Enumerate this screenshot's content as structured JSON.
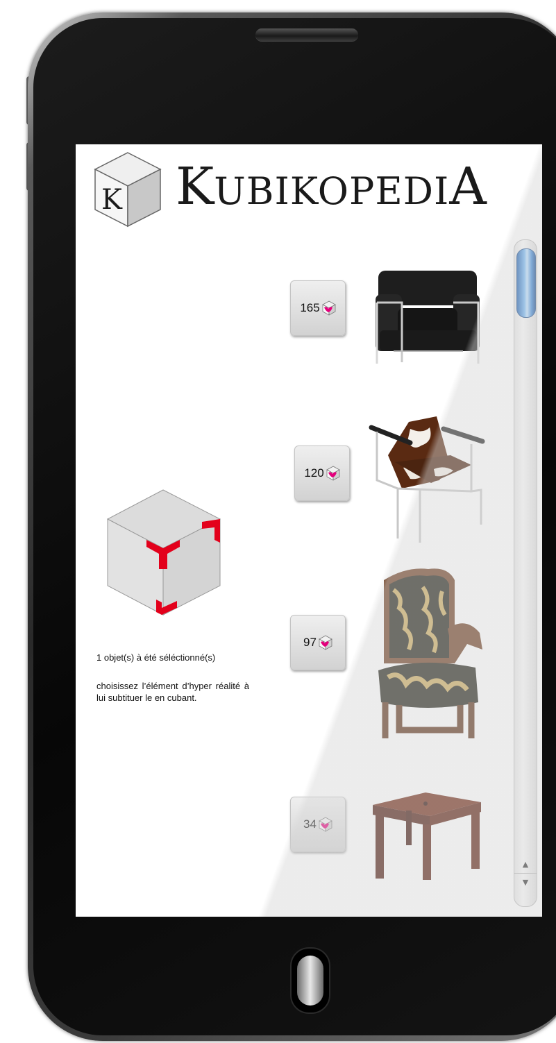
{
  "app": {
    "title_cap": "K",
    "title_middle": "UBIKOPEDI",
    "title_end": "A",
    "logo_letter": "K"
  },
  "status": {
    "selected_message": "1 objet(s) à été séléctionné(s)",
    "instruction": "choisissez l’élément d’hyper réalité à lui subtituer le en cubant."
  },
  "items": [
    {
      "count": "165",
      "object": "black leather lounge armchair"
    },
    {
      "count": "120",
      "object": "cowhide sling chair"
    },
    {
      "count": "97",
      "object": "upholstered carved wooden armchair"
    },
    {
      "count": "34",
      "object": "dark wooden square table"
    }
  ],
  "scrollbar": {
    "up_glyph": "▲",
    "down_glyph": "▼",
    "position_fraction": 0.0
  },
  "colors": {
    "accent_red": "#e3001b",
    "mini_cube_pink": "#e4007c",
    "scroll_thumb_blue": "#3a86d6"
  },
  "icons": {
    "logo": "k-cube-logo-icon",
    "selection": "selection-cube-icon",
    "count": "pink-cube-icon"
  }
}
